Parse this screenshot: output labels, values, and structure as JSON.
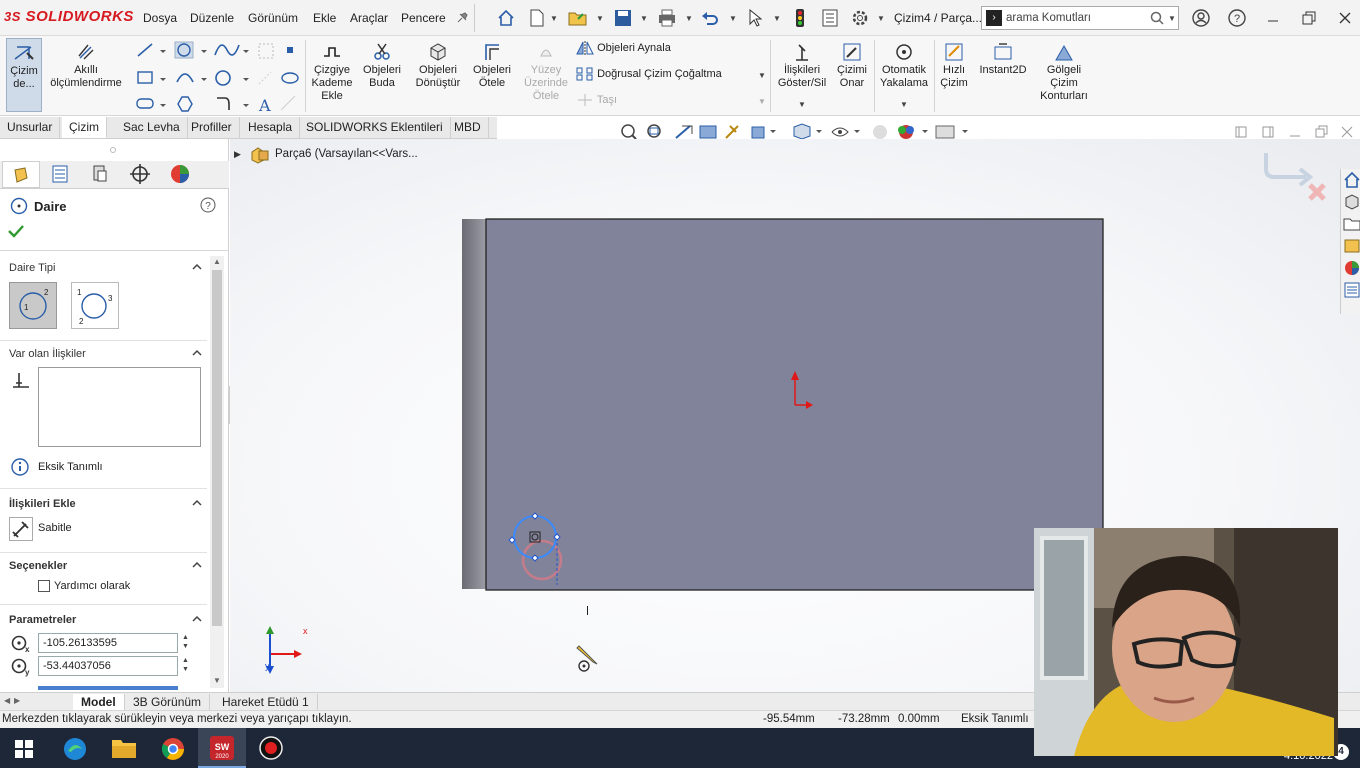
{
  "app": {
    "logo": "SOLIDWORKS",
    "doc_title": "Çizim4 / Parça...",
    "search_placeholder": "arama Komutları"
  },
  "menu": [
    "Dosya",
    "Düzenle",
    "Görünüm",
    "Ekle",
    "Araçlar",
    "Pencere"
  ],
  "commands": {
    "sketch": "Çizim de...",
    "smart_dim": "Akıllı ölçümlendirme",
    "offset": "Çizgiye Kademe Ekle",
    "trim": "Objeleri Buda",
    "convert": "Objeleri Dönüştür",
    "offset_ent": "Objeleri Ötele",
    "surface_offset": "Yüzey Üzerinde Ötele",
    "mirror": "Objeleri Aynala",
    "linear_pattern": "Doğrusal Çizim Çoğaltma",
    "move": "Taşı",
    "relations": "İlişkileri Göster/Sil",
    "repair": "Çizimi Onar",
    "snap": "Otomatik Yakalama",
    "rapid": "Hızlı Çizim",
    "instant2d": "Instant2D",
    "shaded": "Gölgeli Çizim Konturları"
  },
  "tabs": [
    "Unsurlar",
    "Çizim",
    "Sac Levha",
    "Profiller",
    "Hesapla",
    "SOLIDWORKS Eklentileri",
    "MBD"
  ],
  "active_tab": "Çizim",
  "tree": {
    "root": "Parça6  (Varsayılan<<Vars..."
  },
  "property_manager": {
    "title": "Daire",
    "circle_type_label": "Daire Tipi",
    "existing_relations_label": "Var olan İlişkiler",
    "under_defined": "Eksik Tanımlı",
    "add_relations_label": "İlişkileri Ekle",
    "fix_label": "Sabitle",
    "options_label": "Seçenekler",
    "construction_label": "Yardımcı olarak",
    "parameters_label": "Parametreler",
    "x_value": "-105.26133595",
    "y_value": "-53.44037056"
  },
  "bottom_tabs": [
    "Model",
    "3B Görünüm",
    "Hareket Etüdü 1"
  ],
  "status": {
    "message": "Merkezden tıklayarak sürükleyin veya merkezi veya yarıçapı tıklayın.",
    "x": "-95.54mm",
    "y": "-73.28mm",
    "z": "0.00mm",
    "state": "Eksik Tanımlı"
  },
  "taskbar": {
    "date": "4.10.2022",
    "notif": "4"
  },
  "triad": {
    "x": "x",
    "y": "y"
  },
  "colors": {
    "accent_red": "#d71920",
    "sketch_plane": "#81839a",
    "selection_blue": "#3a8bff"
  }
}
